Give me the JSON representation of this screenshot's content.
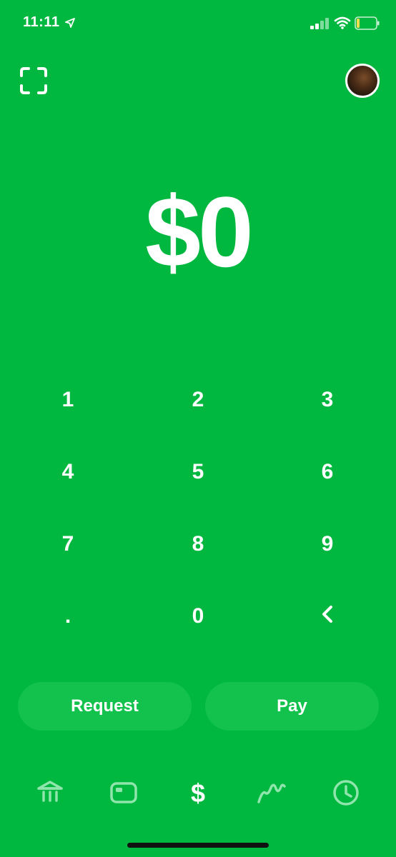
{
  "status_bar": {
    "time": "11:11"
  },
  "main": {
    "amount": "$0"
  },
  "keypad": {
    "keys": [
      "1",
      "2",
      "3",
      "4",
      "5",
      "6",
      "7",
      "8",
      "9",
      ".",
      "0"
    ]
  },
  "actions": {
    "request_label": "Request",
    "pay_label": "Pay"
  },
  "tabs": [
    {
      "icon": "bank-icon"
    },
    {
      "icon": "card-icon"
    },
    {
      "icon": "dollar-icon"
    },
    {
      "icon": "investing-icon"
    },
    {
      "icon": "clock-icon"
    }
  ],
  "colors": {
    "background": "#00B83F",
    "button_fill": "#12C24C",
    "text": "#ffffff"
  }
}
